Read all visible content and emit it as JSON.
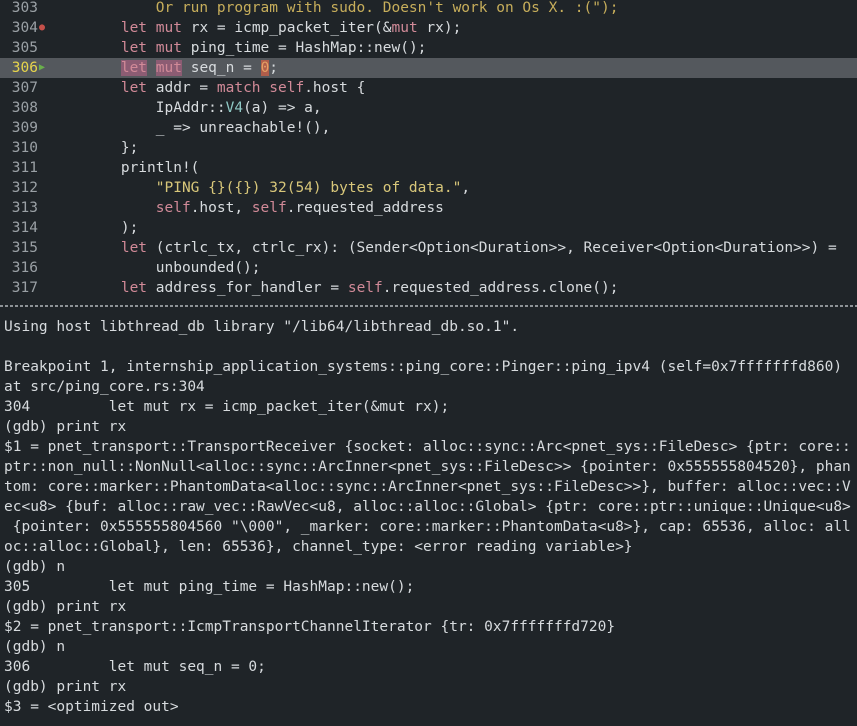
{
  "editor": {
    "current_line": "306",
    "lines": [
      {
        "num": "303",
        "marker": "",
        "text": "            Or run program with sudo. Doesn't work on Os X. :(\");"
      },
      {
        "num": "304",
        "marker": "breakpoint",
        "text": "        let mut rx = icmp_packet_iter(&mut rx);"
      },
      {
        "num": "305",
        "marker": "",
        "text": "        let mut ping_time = HashMap::new();"
      },
      {
        "num": "306",
        "marker": "current",
        "text": "        let mut seq_n = 0;"
      },
      {
        "num": "307",
        "marker": "",
        "text": "        let addr = match self.host {"
      },
      {
        "num": "308",
        "marker": "",
        "text": "            IpAddr::V4(a) => a,"
      },
      {
        "num": "309",
        "marker": "",
        "text": "            _ => unreachable!(),"
      },
      {
        "num": "310",
        "marker": "",
        "text": "        };"
      },
      {
        "num": "311",
        "marker": "",
        "text": "        println!("
      },
      {
        "num": "312",
        "marker": "",
        "text": "            \"PING {}({}) 32(54) bytes of data.\","
      },
      {
        "num": "313",
        "marker": "",
        "text": "            self.host, self.requested_address"
      },
      {
        "num": "314",
        "marker": "",
        "text": "        );"
      },
      {
        "num": "315",
        "marker": "",
        "text": "        let (ctrlc_tx, ctrlc_rx): (Sender<Option<Duration>>, Receiver<Option<Duration>>) ="
      },
      {
        "num": "316",
        "marker": "",
        "text": "            unbounded();"
      },
      {
        "num": "317",
        "marker": "",
        "text": "        let address_for_handler = self.requested_address.clone();"
      }
    ]
  },
  "console": {
    "lines": [
      "Using host libthread_db library \"/lib64/libthread_db.so.1\".",
      "",
      "Breakpoint 1, internship_application_systems::ping_core::Pinger::ping_ipv4 (self=0x7fffffffd860)",
      "at src/ping_core.rs:304",
      "304         let mut rx = icmp_packet_iter(&mut rx);",
      "(gdb) print rx",
      "$1 = pnet_transport::TransportReceiver {socket: alloc::sync::Arc<pnet_sys::FileDesc> {ptr: core::",
      "ptr::non_null::NonNull<alloc::sync::ArcInner<pnet_sys::FileDesc>> {pointer: 0x555555804520}, phan",
      "tom: core::marker::PhantomData<alloc::sync::ArcInner<pnet_sys::FileDesc>>}, buffer: alloc::vec::V",
      "ec<u8> {buf: alloc::raw_vec::RawVec<u8, alloc::alloc::Global> {ptr: core::ptr::unique::Unique<u8>",
      " {pointer: 0x555555804560 \"\\000\", _marker: core::marker::PhantomData<u8>}, cap: 65536, alloc: all",
      "oc::alloc::Global}, len: 65536}, channel_type: <error reading variable>}",
      "(gdb) n",
      "305         let mut ping_time = HashMap::new();",
      "(gdb) print rx",
      "$2 = pnet_transport::IcmpTransportChannelIterator {tr: 0x7fffffffd720}",
      "(gdb) n",
      "306         let mut seq_n = 0;",
      "(gdb) print rx",
      "$3 = <optimized out>"
    ]
  }
}
